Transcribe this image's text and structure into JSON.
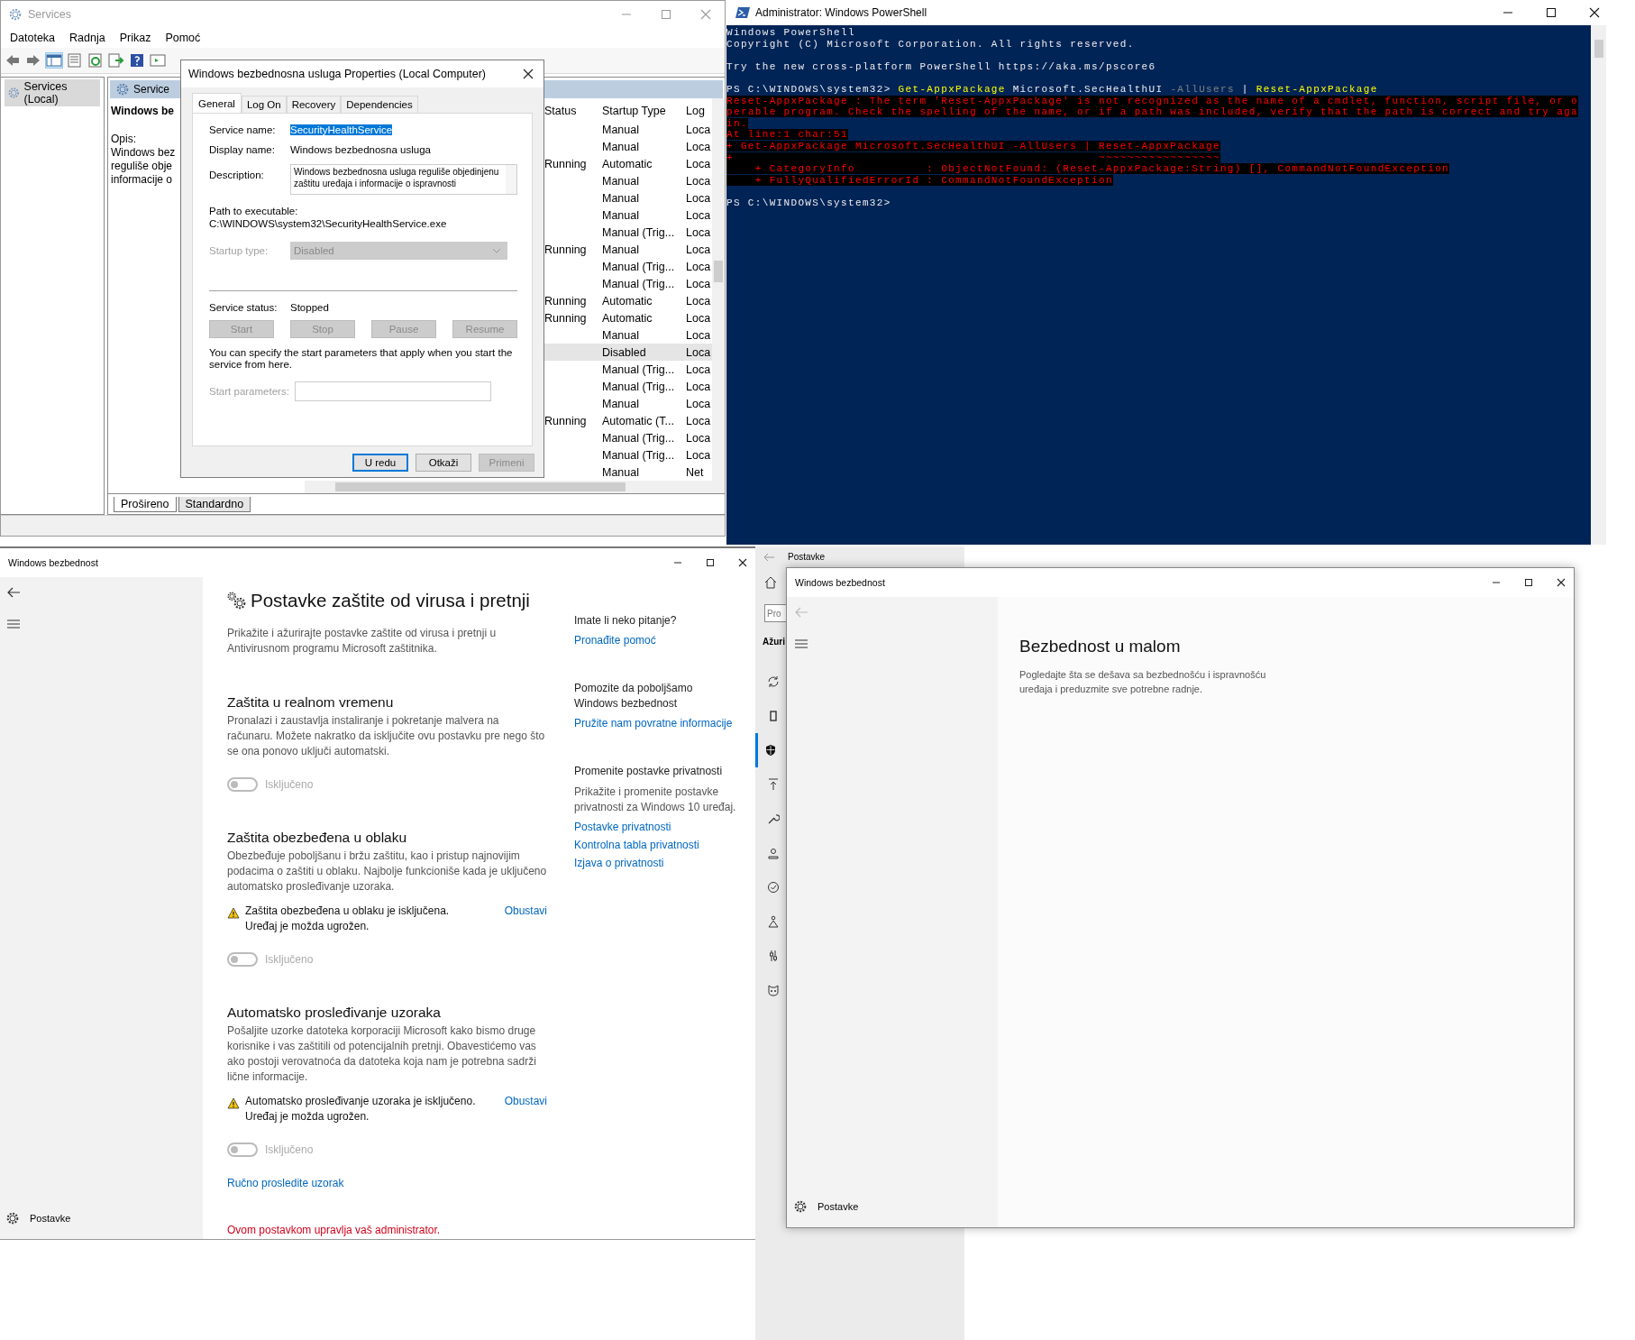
{
  "services_window": {
    "title": "Services",
    "menu": [
      "Datoteka",
      "Radnja",
      "Prikaz",
      "Pomoć"
    ],
    "tree": [
      {
        "label": "Services (Local)",
        "selected": true
      }
    ],
    "pane_header": "Service",
    "detail": {
      "name": "Windows be",
      "label": "Opis:",
      "lines": [
        "Windows bez",
        "reguliše obje",
        "informacije o"
      ]
    },
    "columns": [
      "Status",
      "Startup Type",
      "Log"
    ],
    "rows": [
      {
        "startup": "Manual",
        "log": "Loca",
        "selected": false
      },
      {
        "startup": "Manual",
        "log": "Loca",
        "selected": false
      },
      {
        "status": "Running",
        "startup": "Automatic",
        "log": "Loca",
        "selected": false
      },
      {
        "startup": "Manual",
        "log": "Loca",
        "selected": false
      },
      {
        "startup": "Manual",
        "log": "Loca",
        "selected": false
      },
      {
        "startup": "Manual",
        "log": "Loca",
        "selected": false
      },
      {
        "startup": "Manual (Trig...",
        "log": "Loca",
        "selected": false
      },
      {
        "status": "Running",
        "startup": "Manual",
        "log": "Loca",
        "selected": false
      },
      {
        "startup": "Manual (Trig...",
        "log": "Loca",
        "selected": false
      },
      {
        "startup": "Manual (Trig...",
        "log": "Loca",
        "selected": false
      },
      {
        "status": "Running",
        "startup": "Automatic",
        "log": "Loca",
        "selected": false
      },
      {
        "status": "Running",
        "startup": "Automatic",
        "log": "Loca",
        "selected": false
      },
      {
        "startup": "Manual",
        "log": "Loca",
        "selected": false
      },
      {
        "startup": "Disabled",
        "log": "Loca",
        "selected": true
      },
      {
        "startup": "Manual (Trig...",
        "log": "Loca",
        "selected": false
      },
      {
        "startup": "Manual (Trig...",
        "log": "Loca",
        "selected": false
      },
      {
        "startup": "Manual",
        "log": "Loca",
        "selected": false
      },
      {
        "status": "Running",
        "startup": "Automatic (T...",
        "log": "Loca",
        "selected": false
      },
      {
        "startup": "Manual (Trig...",
        "log": "Loca",
        "selected": false
      },
      {
        "startup": "Manual (Trig...",
        "log": "Loca",
        "selected": false
      },
      {
        "startup": "Manual",
        "log": "Net",
        "selected": false
      }
    ],
    "bottom_tabs": [
      {
        "label": "Prošireno",
        "selected": true
      },
      {
        "label": "Standardno",
        "selected": false
      }
    ]
  },
  "properties_dialog": {
    "title": "Windows bezbednosna usluga Properties (Local Computer)",
    "tabs": [
      {
        "label": "General",
        "selected": true
      },
      {
        "label": "Log On",
        "selected": false
      },
      {
        "label": "Recovery",
        "selected": false
      },
      {
        "label": "Dependencies",
        "selected": false
      }
    ],
    "service_name": {
      "label": "Service name:",
      "value": "SecurityHealthService",
      "text_selected": true
    },
    "display_name": {
      "label": "Display name:",
      "value": "Windows bezbednosna usluga"
    },
    "description": {
      "label": "Description:",
      "value": "Windows bezbednosna usluga reguliše objedinjenu zaštitu uređaja i informacije o ispravnosti"
    },
    "path": {
      "label": "Path to executable:",
      "value": "C:\\WINDOWS\\system32\\SecurityHealthService.exe"
    },
    "startup_type": {
      "label": "Startup type:",
      "value": "Disabled",
      "disabled": true
    },
    "service_status": {
      "label": "Service status:",
      "value": "Stopped"
    },
    "control_buttons": [
      {
        "label": "Start",
        "disabled": true
      },
      {
        "label": "Stop",
        "disabled": true
      },
      {
        "label": "Pause",
        "disabled": true
      },
      {
        "label": "Resume",
        "disabled": true
      }
    ],
    "hint": "You can specify the start parameters that apply when you start the service from here.",
    "start_parameters": {
      "label": "Start parameters:",
      "disabled": true
    },
    "buttons": [
      {
        "label": "U redu",
        "default": true,
        "disabled": false
      },
      {
        "label": "Otkaži",
        "default": false,
        "disabled": false
      },
      {
        "label": "Primeni",
        "default": false,
        "disabled": true
      }
    ]
  },
  "powershell": {
    "title": "Administrator: Windows PowerShell",
    "lines": [
      {
        "kind": "text",
        "segments": [
          {
            "text": "Windows PowerShell",
            "kind": "out"
          }
        ]
      },
      {
        "kind": "text",
        "segments": [
          {
            "text": "Copyright (C) Microsoft Corporation. All rights reserved.",
            "kind": "out"
          }
        ]
      },
      {
        "kind": "blank"
      },
      {
        "kind": "text",
        "segments": [
          {
            "text": "Try the new cross-platform PowerShell https://aka.ms/pscore6",
            "kind": "out"
          }
        ]
      },
      {
        "kind": "blank"
      },
      {
        "kind": "text",
        "segments": [
          {
            "text": "PS C:\\WINDOWS\\system32> ",
            "kind": "out"
          },
          {
            "text": "Get-AppxPackage",
            "kind": "cmd"
          },
          {
            "text": " Microsoft.SecHealthUI ",
            "kind": "out"
          },
          {
            "text": "-AllUsers",
            "kind": "param"
          },
          {
            "text": " | ",
            "kind": "out"
          },
          {
            "text": "Reset-AppxPackage",
            "kind": "cmd"
          }
        ]
      },
      {
        "kind": "text",
        "segments": [
          {
            "text": "Reset-AppxPackage : The term 'Reset-AppxPackage' is not recognized as the name of a cmdlet, function, script file, or o",
            "kind": "err"
          }
        ]
      },
      {
        "kind": "text",
        "segments": [
          {
            "text": "perable program. Check the spelling of the name, or if a path was included, verify that the path is correct and try aga",
            "kind": "err"
          }
        ]
      },
      {
        "kind": "text",
        "segments": [
          {
            "text": "in.",
            "kind": "err"
          }
        ]
      },
      {
        "kind": "text",
        "segments": [
          {
            "text": "At line:1 char:51",
            "kind": "err"
          }
        ]
      },
      {
        "kind": "text",
        "segments": [
          {
            "text": "+ Get-AppxPackage Microsoft.SecHealthUI -AllUsers | Reset-AppxPackage",
            "kind": "err"
          }
        ]
      },
      {
        "kind": "text",
        "segments": [
          {
            "text": "+                                                   ~~~~~~~~~~~~~~~~~",
            "kind": "err"
          }
        ]
      },
      {
        "kind": "text",
        "segments": [
          {
            "text": "    + CategoryInfo          : ObjectNotFound: (Reset-AppxPackage:String) [], CommandNotFoundException",
            "kind": "err"
          }
        ]
      },
      {
        "kind": "text",
        "segments": [
          {
            "text": "    + FullyQualifiedErrorId : CommandNotFoundException",
            "kind": "err"
          }
        ]
      },
      {
        "kind": "blank"
      },
      {
        "kind": "text",
        "segments": [
          {
            "text": "PS C:\\WINDOWS\\system32>",
            "kind": "out"
          }
        ]
      }
    ]
  },
  "security_window": {
    "title": "Windows bezbednost",
    "back_enabled": true,
    "nav_footer": "Postavke",
    "heading": "Postavke zaštite od virusa i pretnji",
    "intro": "Prikažite i ažurirajte postavke zaštite od virusa i pretnji u Antivirusnom programu Microsoft zaštitnika.",
    "sections": [
      {
        "title": "Zaštita u realnom vremenu",
        "description": "Pronalazi i zaustavlja instaliranje i pokretanje malvera na računaru. Možete nakratko da isključite ovu postavku pre nego što se ona ponovo uključi automatski.",
        "toggle": {
          "on": false,
          "label": "Isključeno"
        }
      },
      {
        "title": "Zaštita obezbeđena u oblaku",
        "description": "Obezbeđuje poboljšanu i bržu zaštitu, kao i pristup najnovijim podacima o zaštiti u oblaku. Najbolje funkcioniše kada je uključeno automatsko prosleđivanje uzoraka.",
        "warning": {
          "text": "Zaštita obezbeđena u oblaku je isključena. Uređaj je možda ugrožen.",
          "link": "Obustavi"
        },
        "toggle": {
          "on": false,
          "label": "Isključeno"
        }
      },
      {
        "title": "Automatsko prosleđivanje uzoraka",
        "description": "Pošaljite uzorke datoteka korporaciji Microsoft kako bismo druge korisnike i vas zaštitili od potencijalnih pretnji. Obavestićemo vas ako postoji verovatnoća da datoteka koja nam je potrebna sadrži lične informacije.",
        "warning": {
          "text": "Automatsko prosleđivanje uzoraka je isključeno. Uređaj je možda ugrožen.",
          "link": "Obustavi"
        },
        "toggle": {
          "on": false,
          "label": "Isključeno"
        },
        "link": "Ručno prosledite uzorak"
      }
    ],
    "admin_note": "Ovom postavkom upravlja vaš administrator.",
    "side": [
      {
        "title": "Imate li neko pitanje?",
        "links": [
          "Pronađite pomoć"
        ]
      },
      {
        "title": "Pomozite da poboljšamo Windows bezbednost",
        "links": [
          "Pružite nam povratne informacije"
        ]
      },
      {
        "title": "Promenite postavke privatnosti",
        "text": "Prikažite i promenite postavke privatnosti za Windows 10 uređaj.",
        "links": [
          "Postavke privatnosti",
          "Kontrolna tabla privatnosti",
          "Izjava o privatnosti"
        ]
      }
    ]
  },
  "settings_window": {
    "title": "Postavke",
    "search": {
      "placeholder": "Pro"
    },
    "section": "Ažuri",
    "nav_items": [
      {
        "selected": false
      },
      {
        "selected": false
      },
      {
        "selected": true
      },
      {
        "selected": false
      },
      {
        "selected": false
      },
      {
        "selected": false
      },
      {
        "selected": false
      },
      {
        "selected": false
      },
      {
        "selected": false
      },
      {
        "selected": false
      }
    ]
  },
  "security_window_2": {
    "title": "Windows bezbednost",
    "back_enabled": false,
    "nav_footer": "Postavke",
    "heading": "Bezbednost u malom",
    "intro": "Pogledajte šta se dešava sa bezbednošću i ispravnošću uređaja i preduzmite sve potrebne radnje."
  }
}
